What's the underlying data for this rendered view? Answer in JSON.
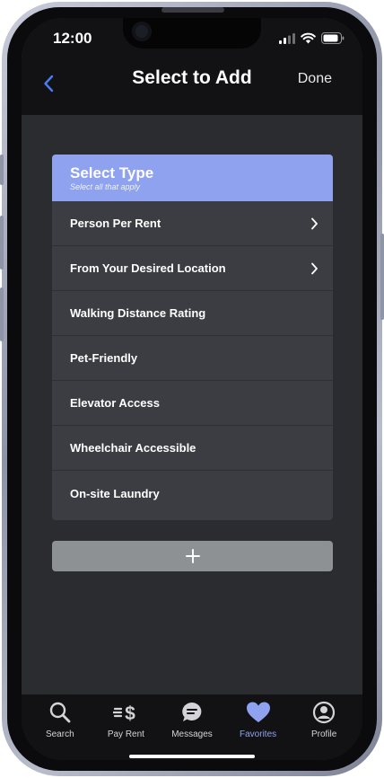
{
  "status": {
    "time": "12:00"
  },
  "nav": {
    "title": "Select to Add",
    "done_label": "Done"
  },
  "select_type": {
    "title": "Select Type",
    "subtitle": "Select all that apply",
    "options": [
      {
        "label": "Person Per Rent",
        "has_chevron": true
      },
      {
        "label": "From Your Desired Location",
        "has_chevron": true
      },
      {
        "label": "Walking Distance Rating",
        "has_chevron": false
      },
      {
        "label": "Pet-Friendly",
        "has_chevron": false
      },
      {
        "label": "Elevator Access",
        "has_chevron": false
      },
      {
        "label": "Wheelchair Accessible",
        "has_chevron": false
      },
      {
        "label": "On-site Laundry",
        "has_chevron": false
      }
    ]
  },
  "add_button": {
    "icon": "plus-icon"
  },
  "tabs": [
    {
      "label": "Search",
      "icon": "search-icon",
      "active": false
    },
    {
      "label": "Pay Rent",
      "icon": "pay-rent-icon",
      "active": false
    },
    {
      "label": "Messages",
      "icon": "messages-icon",
      "active": false
    },
    {
      "label": "Favorites",
      "icon": "heart-icon",
      "active": true
    },
    {
      "label": "Profile",
      "icon": "profile-icon",
      "active": false
    }
  ],
  "colors": {
    "accent": "#8ea2ef",
    "back_arrow": "#4a7cf5",
    "background": "#2b2c30",
    "card": "#3b3d42",
    "bars": "#121214",
    "add_button": "#8e9194"
  }
}
